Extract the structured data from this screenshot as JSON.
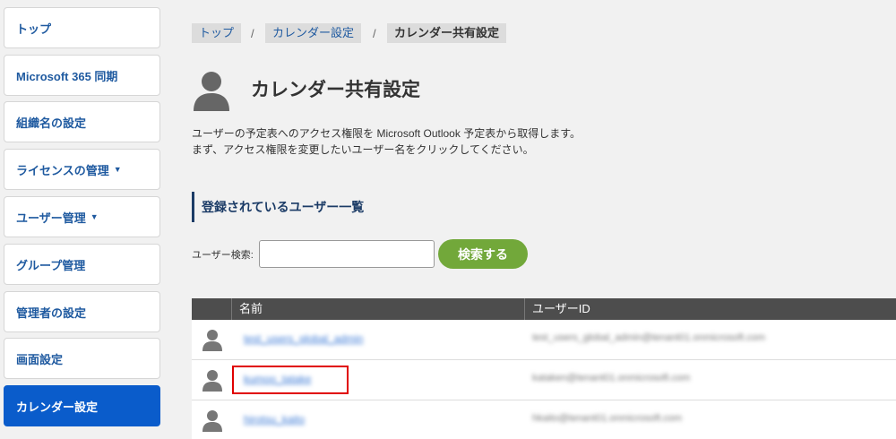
{
  "sidebar": {
    "items": [
      {
        "label": "トップ",
        "arrow": ""
      },
      {
        "label": "Microsoft 365 同期",
        "arrow": ""
      },
      {
        "label": "組織名の設定",
        "arrow": ""
      },
      {
        "label": "ライセンスの管理",
        "arrow": "▼"
      },
      {
        "label": "ユーザー管理",
        "arrow": "▼"
      },
      {
        "label": "グループ管理",
        "arrow": ""
      },
      {
        "label": "管理者の設定",
        "arrow": ""
      },
      {
        "label": "画面設定",
        "arrow": ""
      },
      {
        "label": "カレンダー設定",
        "arrow": ""
      }
    ]
  },
  "breadcrumb": {
    "items": [
      "トップ",
      "カレンダー設定",
      "カレンダー共有設定"
    ],
    "separator": "/"
  },
  "page": {
    "title": "カレンダー共有設定",
    "desc_line1": "ユーザーの予定表へのアクセス権限を Microsoft Outlook 予定表から取得します。",
    "desc_line2": "まず、アクセス権限を変更したいユーザー名をクリックしてください。"
  },
  "section": {
    "heading": "登録されているユーザー一覧"
  },
  "search": {
    "label": "ユーザー検索:",
    "value": "",
    "button": "検索する"
  },
  "table": {
    "headers": [
      "名前",
      "ユーザーID"
    ],
    "rows": [
      {
        "name": "test_users_global_admin",
        "id": "test_users_global_admin@tenant01.onmicrosoft.com"
      },
      {
        "name": "kumoo_tatake",
        "id": "kataken@tenant01.onmicrosoft.com"
      },
      {
        "name": "hirotsu_kaito",
        "id": "hkaito@tenant01.onmicrosoft.com"
      }
    ]
  },
  "colors": {
    "active": "#0a5ccb",
    "link": "#1f5aa0",
    "button": "#72a83a",
    "highlight": "#e00000"
  },
  "icons": [
    "user-silhouette-icon"
  ]
}
